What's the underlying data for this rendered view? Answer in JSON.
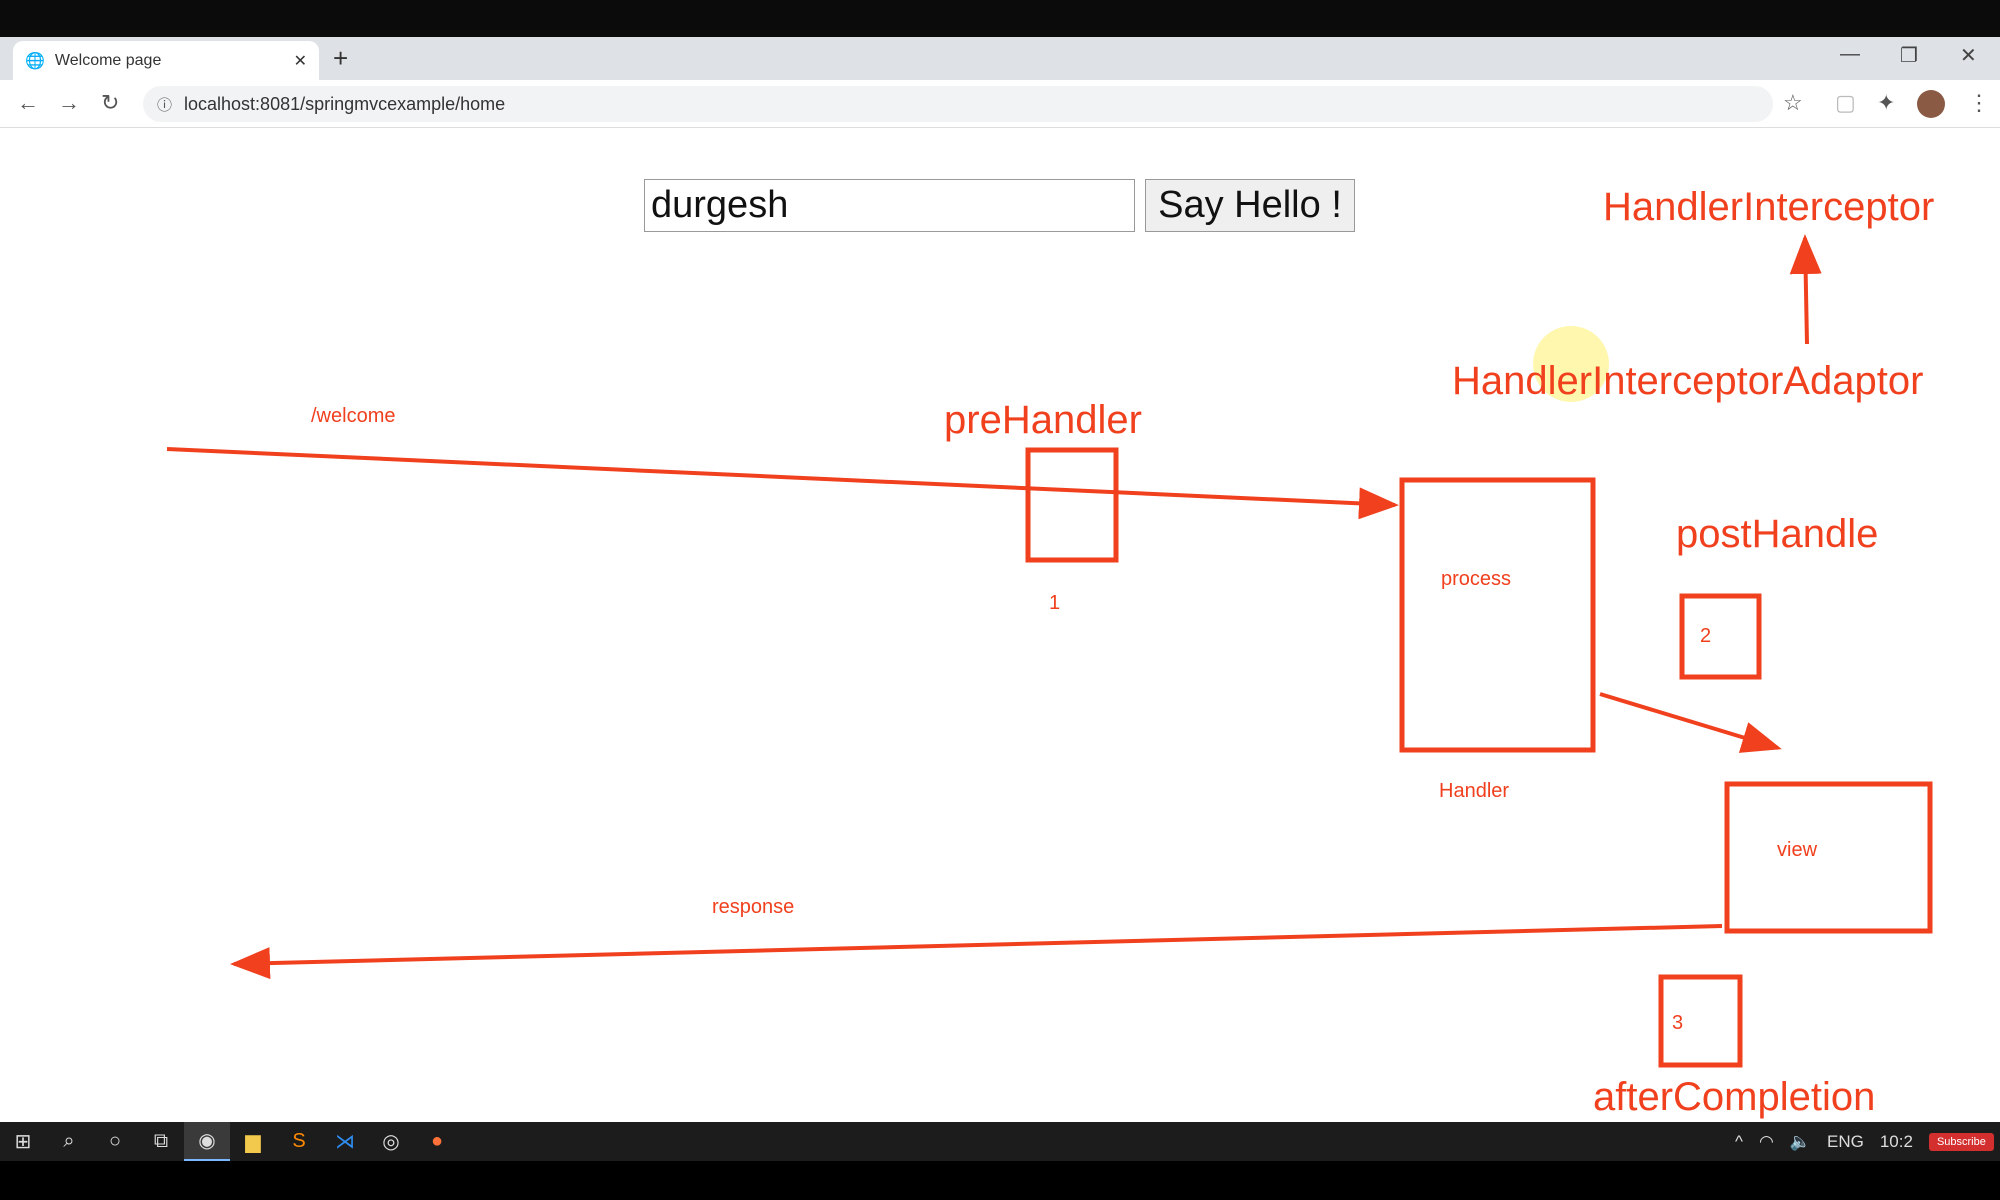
{
  "browser": {
    "tab_title": "Welcome page",
    "url": "localhost:8081/springmvcexample/home"
  },
  "form": {
    "input_value": "durgesh",
    "button_label": "Say Hello !"
  },
  "diagram": {
    "color": "#f0401e",
    "labels": {
      "handler_interceptor": "HandlerInterceptor",
      "handler_interceptor_adaptor": "HandlerInterceptorAdaptor",
      "welcome": "/welcome",
      "pre_handler": "preHandler",
      "step1": "1",
      "process": "process",
      "handler": "Handler",
      "post_handle": "postHandle",
      "step2": "2",
      "view": "view",
      "response": "response",
      "step3": "3",
      "after_completion": "afterCompletion"
    }
  },
  "taskbar": {
    "language": "ENG",
    "clock": "10:2",
    "subscribe": "Subscribe"
  }
}
